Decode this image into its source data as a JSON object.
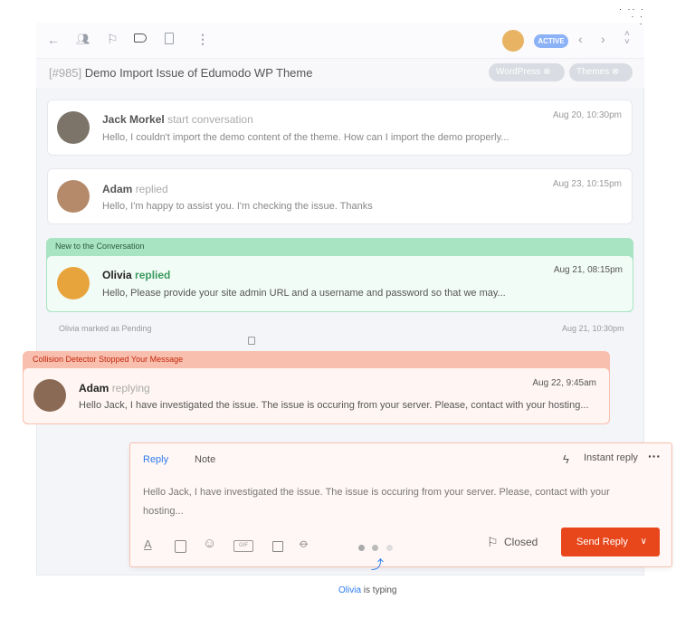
{
  "toolbar": {
    "icons": [
      "arrow-left-icon",
      "users-icon",
      "flag-icon",
      "tag-icon",
      "trash-icon",
      "more-vertical-icon"
    ],
    "status": "ACTIVE"
  },
  "ticket": {
    "id": "[#985]",
    "title": "Demo Import Issue of Edumodo WP Theme",
    "tags": [
      "WordPress",
      "Themes"
    ]
  },
  "messages": [
    {
      "name": "Jack Morkel",
      "action": "start conversation",
      "time": "Aug 20, 10:30pm",
      "text": "Hello, I couldn't import the demo content of the theme. How can I import the demo properly..."
    },
    {
      "name": "Adam",
      "action": "replied",
      "time": "Aug 23, 10:15pm",
      "text": "Hello, I'm happy to assist you. I'm checking the issue. Thanks"
    },
    {
      "name": "Olivia",
      "action": "replied",
      "time": "Aug 21, 08:15pm",
      "text": "Hello, Please provide your site admin URL and a username and password so that we may..."
    }
  ],
  "new_banner": "New to the Conversation",
  "status_event": {
    "text": "Olivia marked as Pending",
    "time": "Aug 21, 10:30pm"
  },
  "collision": {
    "banner": "Collision Detector Stopped Your Message",
    "name": "Adam",
    "action": "replying",
    "time": "Aug 22, 9:45am",
    "text": "Hello Jack, I have investigated the issue. The issue is occuring from your server. Please, contact with your hosting..."
  },
  "reply": {
    "tabs": [
      "Reply",
      "Note"
    ],
    "instant": "Instant reply",
    "body": "Hello Jack, I have investigated the issue. The issue is occuring from your server. Please, contact with your hosting...",
    "status": "Closed",
    "send": "Send Reply",
    "gif": "GIF"
  },
  "typing": {
    "name": "Olivia",
    "text": "is typing"
  },
  "colors": {
    "accent": "#2f7cf0",
    "send": "#e8461b",
    "green": "#a8e3c2",
    "collision": "#f9bfae"
  }
}
